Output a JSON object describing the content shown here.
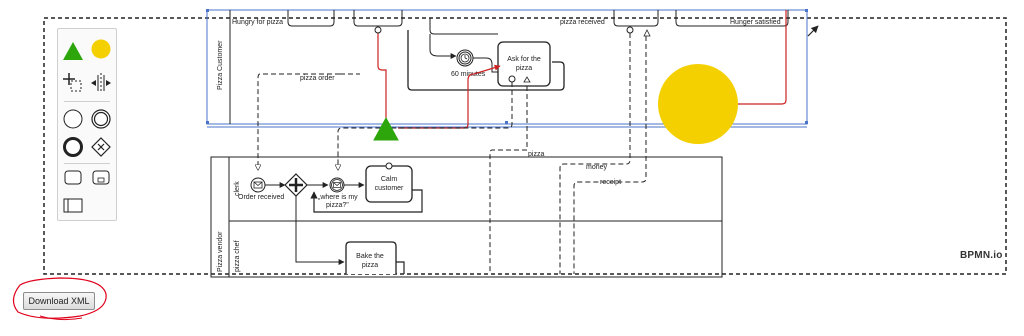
{
  "diagram": {
    "lanes": {
      "customer_pool_label": "Pizza Customer",
      "vendor_pool_label": "Pizza vendor",
      "clerk_lane_label": "clerk",
      "chef_lane_label": "pizza chef"
    },
    "tasks": {
      "ask_for_pizza": [
        "Ask for the",
        "pizza"
      ],
      "calm_customer": [
        "Calm",
        "customer"
      ],
      "bake_pizza": [
        "Bake the",
        "pizza"
      ]
    },
    "events": {
      "hungry_for_pizza": "Hungry for pizza",
      "pizza_received": "pizza received",
      "hunger_satisfied": "Hunger satisfied",
      "sixty_minutes": "60 minutes",
      "order_received": "Order received",
      "where_is_my_pizza": [
        "„where is my",
        "pizza?\""
      ]
    },
    "messages": {
      "pizza_order": "pizza order",
      "pizza": "pizza",
      "money": "money",
      "receipt": "receipt"
    }
  },
  "toolbar": {
    "download_label": "Download XML"
  },
  "watermark": {
    "text": "BPMN.io"
  },
  "colors": {
    "selection_blue": "#4a74c9",
    "sequence_red": "#cc2222",
    "triangle_green": "#2da60b",
    "circle_yellow": "#f5d000",
    "annotation_red": "#e0001a"
  },
  "palette_icons": [
    "green-triangle-icon",
    "yellow-circle-icon",
    "hand-tool-icon",
    "space-tool-icon",
    "start-event-icon",
    "intermediate-event-icon",
    "end-event-icon",
    "gateway-icon",
    "task-icon",
    "subprocess-icon",
    "pool-icon"
  ]
}
